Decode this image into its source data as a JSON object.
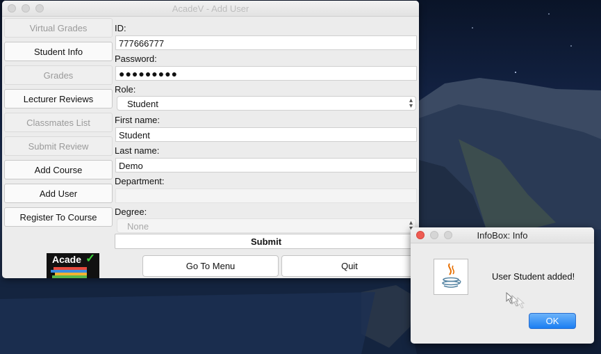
{
  "main_window": {
    "title": "AcadeV - Add User",
    "sidebar": [
      {
        "label": "Virtual Grades",
        "enabled": false
      },
      {
        "label": "Student Info",
        "enabled": true
      },
      {
        "label": "Grades",
        "enabled": false
      },
      {
        "label": "Lecturer Reviews",
        "enabled": true
      },
      {
        "label": "Classmates List",
        "enabled": false
      },
      {
        "label": "Submit Review",
        "enabled": false
      },
      {
        "label": "Add Course",
        "enabled": true
      },
      {
        "label": "Add User",
        "enabled": true
      },
      {
        "label": "Register To Course",
        "enabled": true
      }
    ],
    "form": {
      "id_label": "ID:",
      "id_value": "777666777",
      "password_label": "Password:",
      "password_value": "●●●●●●●●●",
      "role_label": "Role:",
      "role_value": "Student",
      "first_name_label": "First name:",
      "first_name_value": "Student",
      "last_name_label": "Last name:",
      "last_name_value": "Demo",
      "department_label": "Department:",
      "department_value": "",
      "degree_label": "Degree:",
      "degree_value": "None",
      "submit_label": "Submit"
    },
    "footer": {
      "go_to_menu_label": "Go To Menu",
      "quit_label": "Quit",
      "logo_text": "Acade"
    }
  },
  "info_dialog": {
    "title": "InfoBox: Info",
    "icon": "java-icon",
    "message": "User Student added!",
    "ok_label": "OK"
  },
  "colors": {
    "accent_button": "#1a7ef2",
    "close_red": "#ee5b52",
    "logo_check": "#3bd13b"
  }
}
